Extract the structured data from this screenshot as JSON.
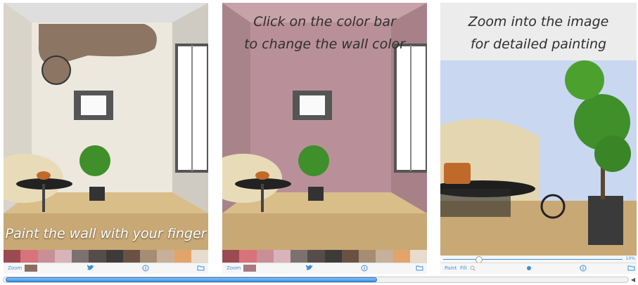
{
  "panels": [
    {
      "caption": "Paint the wall with your finger",
      "toolbar": {
        "zoom_label": "Zoom",
        "current_color": "#8a6f60"
      }
    },
    {
      "caption_line1": "Click on the color bar",
      "caption_line2": "to change the wall color",
      "toolbar": {
        "zoom_label": "Zoom",
        "current_color": "#a87a80"
      }
    },
    {
      "caption_line1": "Zoom into the image",
      "caption_line2": "for detailed painting",
      "toolbar": {
        "paint_label": "Paint",
        "fill_label": "Fill",
        "zoom_percent": "10%"
      }
    }
  ],
  "swatch_colors": [
    "#9b4a52",
    "#d9727a",
    "#c98f98",
    "#d8b4ba",
    "#7b7170",
    "#554c4b",
    "#3d3b3a",
    "#6a5144",
    "#a58c73",
    "#c7b09a",
    "#e2a46a",
    "#e8dccd",
    "#ddd3c8",
    "#eee8e1"
  ],
  "icons": [
    "twitter-icon",
    "info-icon",
    "folder-icon",
    "record-icon"
  ],
  "wall_colors": {
    "panel1": "#ece8de",
    "panel2": "#b99099",
    "panel3": "#c9d8f0"
  },
  "paint_stroke_color": "#8c7563"
}
